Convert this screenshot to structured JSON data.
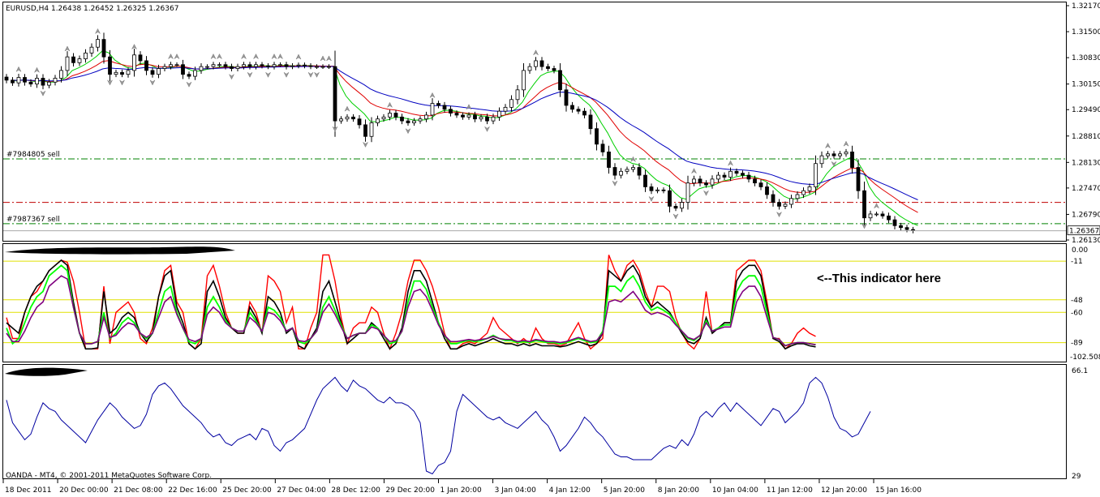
{
  "window": {
    "symbol_header": "EURUSD,H4  1.26438 1.26452 1.26325 1.26367",
    "copyright": "OANDA - MT4, © 2001-2011 MetaQuotes Software Corp."
  },
  "colors": {
    "candle_up_fill": "#ffffff",
    "candle_down_fill": "#000000",
    "ma_blue": "#0000c0",
    "ma_red": "#e00000",
    "ma_green": "#00d000",
    "level_lines": "#e0e000",
    "order_line_green": "#008000",
    "order_line_red": "#c00000",
    "ind_red": "#ff0000",
    "ind_black": "#000000",
    "ind_green": "#00ff00",
    "ind_purple": "#800080",
    "sub2_line": "#0000a0"
  },
  "annotation": {
    "text": "<--This indicator here"
  },
  "orders": [
    {
      "label": "#7984805 sell",
      "price": 1.2822,
      "line": "green"
    },
    {
      "label": "#7987367 sell",
      "price": 1.2655,
      "line": "green"
    },
    {
      "label": "",
      "price": 1.271,
      "line": "red"
    }
  ],
  "chart_data": [
    {
      "type": "candlestick",
      "title": "EURUSD,H4",
      "ylim": [
        1.2613,
        1.3217
      ],
      "y_ticks": [
        "1.32170",
        "1.31500",
        "1.30830",
        "1.30150",
        "1.29490",
        "1.28810",
        "1.28130",
        "1.27470",
        "1.26790",
        "1.26130"
      ],
      "current_price_label": "1.26367",
      "x_ticks": [
        "18 Dec 2011",
        "20 Dec 00:00",
        "21 Dec 08:00",
        "22 Dec 16:00",
        "25 Dec 20:00",
        "27 Dec 04:00",
        "28 Dec 12:00",
        "29 Dec 20:00",
        "1 Jan 20:00",
        "3 Jan 04:00",
        "4 Jan 12:00",
        "5 Jan 20:00",
        "8 Jan 20:00",
        "10 Jan 04:00",
        "11 Jan 12:00",
        "12 Jan 20:00",
        "15 Jan 16:00"
      ],
      "close_approx": [
        1.3025,
        1.3018,
        1.3032,
        1.302,
        1.3015,
        1.303,
        1.3012,
        1.302,
        1.303,
        1.305,
        1.3085,
        1.307,
        1.308,
        1.3095,
        1.311,
        1.313,
        1.3085,
        1.304,
        1.3045,
        1.304,
        1.305,
        1.309,
        1.3075,
        1.305,
        1.304,
        1.3055,
        1.306,
        1.3065,
        1.3065,
        1.304,
        1.3035,
        1.305,
        1.306,
        1.306,
        1.3065,
        1.3065,
        1.306,
        1.3055,
        1.306,
        1.3065,
        1.306,
        1.3065,
        1.3062,
        1.306,
        1.3065,
        1.3065,
        1.306,
        1.3062,
        1.3064,
        1.3062,
        1.306,
        1.306,
        1.306,
        1.306,
        1.292,
        1.2925,
        1.293,
        1.2925,
        1.291,
        1.288,
        1.2915,
        1.2925,
        1.293,
        1.294,
        1.293,
        1.292,
        1.2915,
        1.292,
        1.2925,
        1.2935,
        1.2965,
        1.296,
        1.295,
        1.294,
        1.2935,
        1.293,
        1.2935,
        1.2925,
        1.293,
        1.292,
        1.293,
        1.2945,
        1.2955,
        1.2975,
        1.3,
        1.305,
        1.306,
        1.3075,
        1.306,
        1.3055,
        1.305,
        1.3,
        1.296,
        1.295,
        1.2945,
        1.2935,
        1.29,
        1.286,
        1.284,
        1.28,
        1.278,
        1.279,
        1.2795,
        1.28,
        1.278,
        1.275,
        1.274,
        1.2742,
        1.274,
        1.27,
        1.2695,
        1.271,
        1.276,
        1.277,
        1.276,
        1.2755,
        1.277,
        1.278,
        1.2775,
        1.279,
        1.2785,
        1.278,
        1.277,
        1.276,
        1.275,
        1.273,
        1.271,
        1.27,
        1.2705,
        1.272,
        1.273,
        1.274,
        1.275,
        1.281,
        1.283,
        1.2835,
        1.283,
        1.2835,
        1.284,
        1.28,
        1.274,
        1.267,
        1.268,
        1.268,
        1.2675,
        1.2665,
        1.265,
        1.2645,
        1.264,
        1.2637
      ]
    },
    {
      "type": "line",
      "title": "",
      "ylim": [
        -102.508,
        0.0
      ],
      "y_ticks": [
        "0.00"
      ],
      "bottom_label": "-102.508",
      "levels": [
        {
          "label": "-11",
          "value": -11
        },
        {
          "label": "-48",
          "value": -48
        },
        {
          "label": "-60",
          "value": -60
        },
        {
          "label": "-89",
          "value": -89
        }
      ],
      "series": [
        {
          "color": "red",
          "values": [
            -65,
            -85,
            -85,
            -60,
            -45,
            -40,
            -30,
            -20,
            -15,
            -10,
            -12,
            -30,
            -60,
            -95,
            -95,
            -95,
            -35,
            -90,
            -60,
            -55,
            -50,
            -60,
            -85,
            -90,
            -75,
            -45,
            -20,
            -15,
            -50,
            -60,
            -90,
            -95,
            -85,
            -25,
            -15,
            -35,
            -60,
            -75,
            -80,
            -80,
            -50,
            -60,
            -80,
            -25,
            -30,
            -40,
            -70,
            -55,
            -95,
            -95,
            -75,
            -60,
            -5,
            -5,
            -30,
            -65,
            -90,
            -75,
            -70,
            -70,
            -55,
            -60,
            -80,
            -95,
            -80,
            -60,
            -30,
            -10,
            -10,
            -20,
            -35,
            -55,
            -80,
            -95,
            -95,
            -90,
            -88,
            -90,
            -85,
            -80,
            -65,
            -75,
            -80,
            -85,
            -90,
            -85,
            -90,
            -75,
            -85,
            -90,
            -90,
            -92,
            -90,
            -80,
            -70,
            -85,
            -95,
            -90,
            -85,
            -5,
            -20,
            -30,
            -15,
            -10,
            -20,
            -40,
            -55,
            -35,
            -35,
            -40,
            -65,
            -80,
            -90,
            -95,
            -85,
            -40,
            -80,
            -75,
            -70,
            -70,
            -20,
            -15,
            -10,
            -10,
            -20,
            -50,
            -85,
            -85,
            -95,
            -90,
            -80,
            -75,
            -80,
            -83
          ]
        },
        {
          "color": "black",
          "values": [
            -70,
            -75,
            -80,
            -60,
            -45,
            -35,
            -30,
            -20,
            -15,
            -10,
            -15,
            -50,
            -80,
            -95,
            -95,
            -94,
            -40,
            -80,
            -75,
            -65,
            -60,
            -65,
            -80,
            -88,
            -80,
            -45,
            -25,
            -20,
            -55,
            -70,
            -90,
            -95,
            -90,
            -40,
            -30,
            -45,
            -65,
            -75,
            -80,
            -80,
            -55,
            -65,
            -80,
            -45,
            -50,
            -60,
            -80,
            -75,
            -92,
            -95,
            -85,
            -75,
            -40,
            -30,
            -50,
            -70,
            -90,
            -85,
            -80,
            -80,
            -70,
            -75,
            -85,
            -95,
            -90,
            -75,
            -40,
            -20,
            -20,
            -30,
            -50,
            -70,
            -85,
            -95,
            -95,
            -92,
            -90,
            -92,
            -90,
            -88,
            -85,
            -88,
            -90,
            -90,
            -92,
            -90,
            -92,
            -90,
            -92,
            -92,
            -92,
            -93,
            -92,
            -90,
            -88,
            -90,
            -92,
            -90,
            -80,
            -20,
            -25,
            -30,
            -20,
            -15,
            -25,
            -45,
            -55,
            -50,
            -55,
            -60,
            -70,
            -80,
            -88,
            -90,
            -85,
            -65,
            -80,
            -75,
            -70,
            -70,
            -30,
            -20,
            -15,
            -15,
            -25,
            -55,
            -85,
            -88,
            -95,
            -92,
            -90,
            -90,
            -92,
            -93
          ]
        },
        {
          "color": "green",
          "values": [
            -75,
            -90,
            -85,
            -70,
            -55,
            -45,
            -40,
            -25,
            -20,
            -15,
            -20,
            -55,
            -80,
            -90,
            -90,
            -88,
            -60,
            -85,
            -80,
            -70,
            -65,
            -70,
            -80,
            -85,
            -80,
            -60,
            -40,
            -35,
            -60,
            -75,
            -88,
            -90,
            -85,
            -55,
            -45,
            -55,
            -68,
            -75,
            -78,
            -78,
            -60,
            -68,
            -78,
            -55,
            -58,
            -65,
            -78,
            -75,
            -88,
            -90,
            -85,
            -78,
            -55,
            -45,
            -58,
            -72,
            -85,
            -82,
            -80,
            -80,
            -72,
            -75,
            -82,
            -90,
            -88,
            -78,
            -50,
            -30,
            -30,
            -38,
            -55,
            -70,
            -82,
            -90,
            -90,
            -88,
            -87,
            -88,
            -87,
            -85,
            -82,
            -85,
            -87,
            -87,
            -89,
            -88,
            -89,
            -87,
            -88,
            -89,
            -89,
            -90,
            -89,
            -87,
            -85,
            -87,
            -89,
            -88,
            -78,
            -35,
            -35,
            -40,
            -30,
            -25,
            -35,
            -50,
            -58,
            -55,
            -58,
            -62,
            -70,
            -78,
            -85,
            -87,
            -82,
            -68,
            -78,
            -75,
            -72,
            -72,
            -40,
            -30,
            -25,
            -25,
            -35,
            -60,
            -84,
            -86,
            -92,
            -90,
            -89,
            -89,
            -90,
            -91
          ]
        },
        {
          "color": "purple",
          "values": [
            -80,
            -88,
            -88,
            -78,
            -65,
            -55,
            -50,
            -35,
            -30,
            -25,
            -28,
            -55,
            -80,
            -90,
            -90,
            -88,
            -65,
            -84,
            -82,
            -75,
            -70,
            -72,
            -80,
            -84,
            -80,
            -65,
            -50,
            -45,
            -62,
            -75,
            -86,
            -88,
            -85,
            -62,
            -55,
            -60,
            -70,
            -75,
            -78,
            -78,
            -65,
            -70,
            -78,
            -60,
            -62,
            -68,
            -78,
            -75,
            -87,
            -88,
            -85,
            -78,
            -60,
            -52,
            -62,
            -74,
            -85,
            -82,
            -80,
            -80,
            -74,
            -76,
            -82,
            -88,
            -87,
            -78,
            -55,
            -40,
            -38,
            -45,
            -58,
            -72,
            -82,
            -88,
            -88,
            -87,
            -86,
            -87,
            -86,
            -85,
            -83,
            -85,
            -86,
            -86,
            -88,
            -87,
            -88,
            -86,
            -87,
            -88,
            -88,
            -89,
            -88,
            -86,
            -84,
            -86,
            -88,
            -87,
            -80,
            -50,
            -48,
            -50,
            -45,
            -40,
            -48,
            -58,
            -62,
            -60,
            -62,
            -65,
            -72,
            -78,
            -84,
            -86,
            -82,
            -70,
            -78,
            -76,
            -74,
            -74,
            -50,
            -40,
            -35,
            -35,
            -45,
            -65,
            -84,
            -86,
            -92,
            -90,
            -89,
            -89,
            -90,
            -91
          ]
        }
      ]
    },
    {
      "type": "line",
      "title": "",
      "ylim": [
        29,
        66.1
      ],
      "top_label": "66.1",
      "bottom_label": "29",
      "series": [
        {
          "color": "blue",
          "values": [
            56,
            48,
            45,
            42,
            44,
            50,
            55,
            53,
            52,
            49,
            47,
            45,
            43,
            41,
            45,
            49,
            52,
            55,
            53,
            50,
            48,
            46,
            47,
            51,
            58,
            61,
            62,
            60,
            57,
            54,
            52,
            50,
            48,
            45,
            43,
            44,
            41,
            40,
            42,
            43,
            44,
            42,
            46,
            45,
            40,
            38,
            41,
            42,
            44,
            46,
            51,
            56,
            60,
            62,
            64,
            61,
            59,
            63,
            61,
            60,
            58,
            56,
            55,
            57,
            55,
            55,
            54,
            52,
            48,
            31,
            30,
            33,
            34,
            38,
            52,
            58,
            56,
            54,
            52,
            50,
            49,
            50,
            48,
            47,
            46,
            48,
            50,
            52,
            49,
            47,
            43,
            38,
            40,
            43,
            46,
            50,
            48,
            45,
            43,
            40,
            37,
            36,
            36,
            35,
            35,
            35,
            35,
            37,
            39,
            40,
            39,
            42,
            40,
            44,
            50,
            52,
            50,
            53,
            55,
            52,
            55,
            53,
            51,
            49,
            47,
            50,
            53,
            52,
            48,
            50,
            52,
            55,
            62,
            64,
            62,
            57,
            50,
            46,
            45,
            43,
            44,
            48,
            52
          ]
        }
      ]
    }
  ]
}
